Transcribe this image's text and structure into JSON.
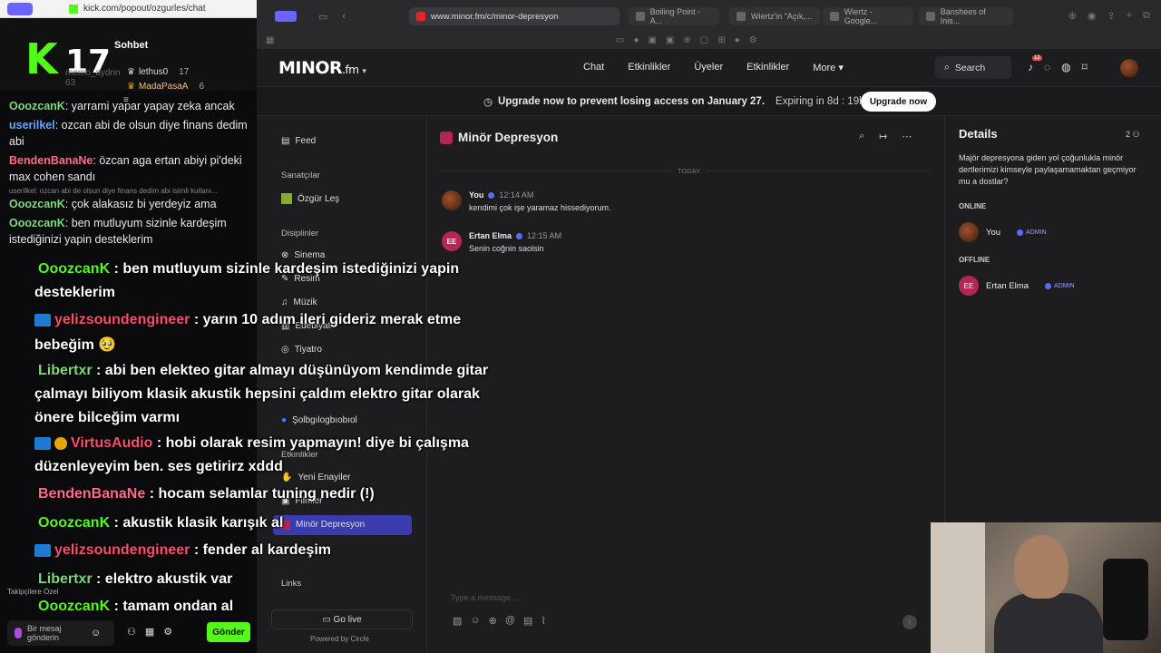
{
  "kick": {
    "url": "kick.com/popout/ozgurles/chat",
    "logo": "K",
    "viewer_count": "17",
    "panel_title": "Sohbet",
    "top_users": [
      {
        "name": "lethus0",
        "count": "17"
      },
      {
        "name": "MadaPasaA",
        "count": "6"
      }
    ],
    "faded_user": "memo_aydnn",
    "faded_count": "63",
    "messages": [
      {
        "nick": "OoozcanK",
        "color": "#7dd87d",
        "text": ": yarrami yapar yapay zeka ancak"
      },
      {
        "nick": "userilkel",
        "color": "#5aa8ff",
        "text": ": ozcan abi de olsun diye finans dedim abi"
      },
      {
        "nick": "BendenBanaNe",
        "color": "#ff6b8a",
        "text": ": özcan aga ertan abiyi pi'deki max cohen sandı"
      },
      {
        "nick": "OoozcanK",
        "color": "#7dd87d",
        "text": ": çok alakasız bi yerdeyiz ama",
        "reply": "userilkel: ozcan abi de olsun diye finans dedim abi isimli kullanı..."
      },
      {
        "nick": "OoozcanK",
        "color": "#7dd87d",
        "text": ": ben mutluyum sizinle kardeşim istediğinizi yapin desteklerim"
      }
    ],
    "followers_only": "Takipçilere Özel",
    "input_placeholder": "Bir mesaj gönderin",
    "send_label": "Gönder"
  },
  "browser": {
    "url": "www.minor.fm/c/minor-depresyon",
    "tabs": [
      "Boiling Point - A...",
      "Wiertz'in \"Açık,...",
      "Wiertz - Google...",
      "Banshees of Inis..."
    ]
  },
  "app": {
    "logo": "MINOR",
    "logo_suffix": ".fm",
    "nav": [
      "Chat",
      "Etkinlikler",
      "Üyeler",
      "Etkinlikler",
      "More"
    ],
    "search_label": "Search",
    "notification_count": "12",
    "banner_text": "Upgrade now to prevent losing access on January 27.",
    "banner_expiry": "Expiring in 8d : 19h : 3m",
    "upgrade_label": "Upgrade now"
  },
  "sidebar": {
    "feed": "Feed",
    "section_artists": "Sanatçılar",
    "artist": "Özgür Leş",
    "section_disciplines": "Disiplinler",
    "disciplines": [
      "Sinema",
      "Resim",
      "Müzik",
      "Edebiyat",
      "Tiyatro",
      "Şolbgılogbıobıol"
    ],
    "section_events": "Etkinlikler",
    "events": [
      "Yeni Enayiler",
      "Filmler",
      "Minör Depresyon"
    ],
    "links_label": "Links",
    "go_live": "Go live",
    "powered": "Powered by Circle"
  },
  "room": {
    "title": "Minör Depresyon",
    "day_label": "TODAY",
    "messages": [
      {
        "author": "You",
        "time": "12:14 AM",
        "text": "kendimi çok işe yaramaz hissediyorum.",
        "avatar": ""
      },
      {
        "author": "Ertan Elma",
        "time": "12:15 AM",
        "text": "Senin coğnin saolsin",
        "avatar": "EE"
      }
    ],
    "composer_placeholder": "Type a message..."
  },
  "details": {
    "title": "Details",
    "member_count": "2",
    "description": "Majör depresyona giden yol çoğunlukla minör dertlerimizi kimseyle paylaşamamaktan geçmiyor mu a dostlar?",
    "online_label": "ONLINE",
    "offline_label": "OFFLINE",
    "online_members": [
      {
        "name": "You",
        "role": "ADMIN"
      }
    ],
    "offline_members": [
      {
        "name": "Ertan Elma",
        "role": "ADMIN",
        "initials": "EE"
      }
    ]
  },
  "overlay": {
    "lines": [
      {
        "nick": "OoozcanK",
        "color": "#53fc18",
        "text": " : ben mutluyum sizinle kardeşim istediğinizi yapin"
      },
      {
        "nick": "",
        "color": "#fff",
        "text": "desteklerim"
      },
      {
        "nick": "yelizsoundengineer",
        "color": "#ff4d6d",
        "text": " : yarın 10 adım ileri gideriz merak etme"
      },
      {
        "nick": "",
        "color": "#fff",
        "text": "bebeğim 🥹"
      },
      {
        "nick": "Libertxr",
        "color": "#7dd87d",
        "text": " : abi ben elekteo gitar almayı düşünüyom kendimde gitar"
      },
      {
        "nick": "",
        "color": "#fff",
        "text": "çalmayı biliyom klasik akustik hepsini çaldım elektro gitar olarak"
      },
      {
        "nick": "",
        "color": "#fff",
        "text": "önere bilceğim varmı"
      },
      {
        "nick": "VirtusAudio",
        "color": "#ff4d6d",
        "text": " : hobi olarak resim yapmayın! diye bi çalışma"
      },
      {
        "nick": "",
        "color": "#fff",
        "text": "düzenleyeyim ben. ses getirirz xddd"
      },
      {
        "nick": "BendenBanaNe",
        "color": "#ff6b8a",
        "text": " : hocam selamlar tuning nedir (!)"
      },
      {
        "nick": "OoozcanK",
        "color": "#53fc18",
        "text": " : akustik klasik karışık al"
      },
      {
        "nick": "yelizsoundengineer",
        "color": "#ff4d6d",
        "text": " : fender al kardeşim"
      },
      {
        "nick": "Libertxr",
        "color": "#7dd87d",
        "text": " : elektro akustik var"
      },
      {
        "nick": "OoozcanK",
        "color": "#53fc18",
        "text": " : tamam ondan al"
      }
    ]
  }
}
